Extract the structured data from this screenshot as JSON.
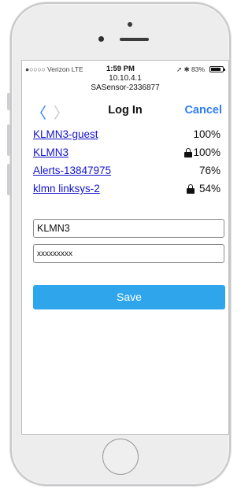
{
  "status_bar": {
    "carrier": "●○○○○ Verizon  LTE",
    "time": "1:59 PM",
    "right_indicators": "➚ ✱ 83%",
    "battery_level": 0.83
  },
  "address": {
    "ip": "10.10.4.1",
    "device": "SASensor-2336877"
  },
  "nav": {
    "back_glyph": "〈",
    "forward_glyph": "〉",
    "title": "Log In",
    "cancel_label": "Cancel"
  },
  "networks": [
    {
      "name": "KLMN3-guest",
      "signal": "100%",
      "locked": false
    },
    {
      "name": "KLMN3",
      "signal": "100%",
      "locked": true
    },
    {
      "name": "Alerts-13847975",
      "signal": "76%",
      "locked": false
    },
    {
      "name": "klmn linksys-2",
      "signal": "54%",
      "locked": true
    }
  ],
  "form": {
    "ssid_value": "KLMN3",
    "password_value": "xxxxxxxxx",
    "save_label": "Save"
  },
  "colors": {
    "accent": "#2f7df6",
    "save_button": "#2fa6ec",
    "link": "#1414cc"
  }
}
